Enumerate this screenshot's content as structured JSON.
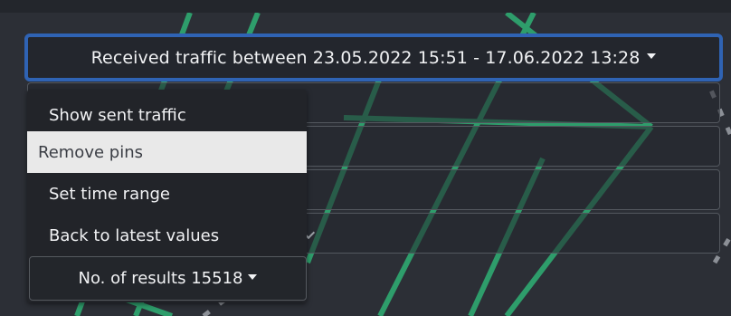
{
  "filter_toggle": {
    "label": "Received traffic between 23.05.2022 15:51 - 17.06.2022 13:28",
    "caret_icon": "caret-down-icon"
  },
  "menu": {
    "items": [
      {
        "label": "Show sent traffic",
        "state": "normal"
      },
      {
        "label": "Remove pins",
        "state": "hovered"
      },
      {
        "label": "Set time range",
        "state": "normal"
      },
      {
        "label": "Back to latest values",
        "state": "normal"
      }
    ]
  },
  "results": {
    "label": "No. of results 15518",
    "caret_icon": "caret-down-icon"
  },
  "colors": {
    "background": "#2c2f36",
    "accent_border": "#2f63b4",
    "map_lines": "#2e9d6b",
    "hover_bg": "#e9e9e9"
  }
}
